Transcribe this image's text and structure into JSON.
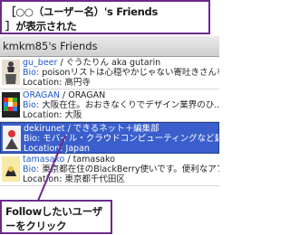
{
  "callout_top": {
    "line1": "［○○（ユーザー名）'s Friends",
    "line2": "］が表示された"
  },
  "screen": {
    "title": "kmkm85's Friends",
    "rows": [
      {
        "name": "gu_beer",
        "display": " / ぐうたりん aka gutarin",
        "bio_key": "Bio:",
        "bio": " poisonリストは心穏やかじゃない寄吐きさんを集...",
        "loc_key": "Location:",
        "loc": " 高円寺",
        "selected": false
      },
      {
        "name": "ORAGAN",
        "display": " / ORAGAN",
        "bio_key": "Bio:",
        "bio": " 大阪在住。おおきなくりでデザイン業界のひ...",
        "loc_key": "Location:",
        "loc": " 大阪",
        "selected": false
      },
      {
        "name": "dekirunet",
        "display": " / できるネット＋編集部",
        "bio_key": "Bio:",
        "bio": " モバイル・クラウドコンピューティングなど最...",
        "loc_key": "Location:",
        "loc": " Japan",
        "selected": true
      },
      {
        "name": "tamasako",
        "display": " / tamasako",
        "bio_key": "Bio:",
        "bio": " 東京都在住のBlackBerry使いです。便利なアプ...",
        "loc_key": "Location:",
        "loc": " 東京都千代田区",
        "selected": false
      }
    ]
  },
  "callout_bottom": {
    "line1": "Followしたいユーザ",
    "line2": "ーをクリック"
  },
  "colors": {
    "callout_border": "#6b2a8c",
    "selection": "#3a5fcd",
    "link": "#1f58c8"
  }
}
